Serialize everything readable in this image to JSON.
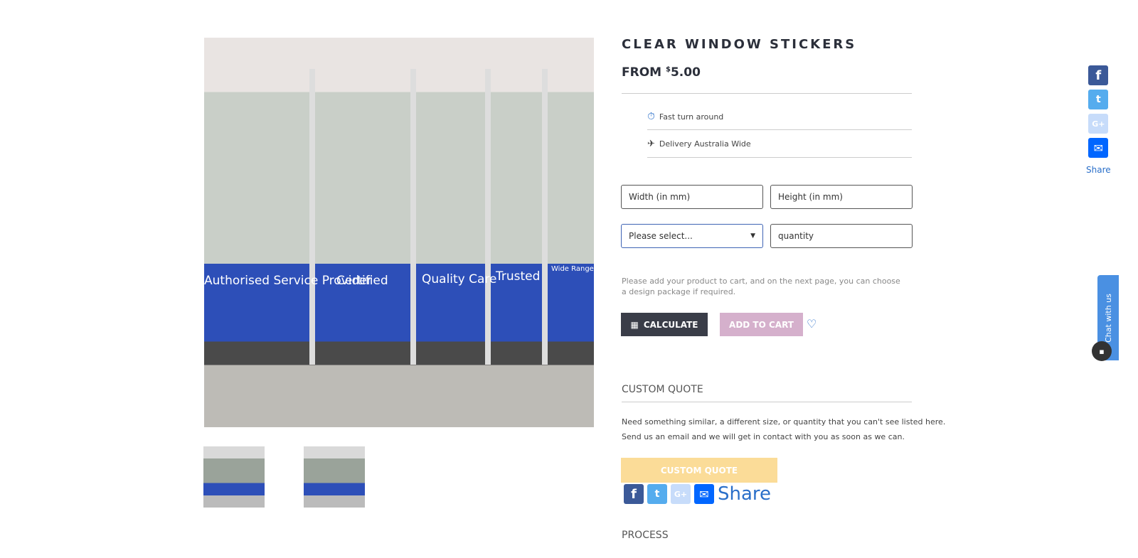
{
  "product": {
    "title": "CLEAR WINDOW STICKERS",
    "price_prefix": "FROM",
    "currency": "$",
    "price": "5.00"
  },
  "photo_signs": [
    "Authorised Service Provider",
    "Certified",
    "Quality Care",
    "Trusted",
    "Wide Range"
  ],
  "features": [
    {
      "icon": "stopwatch-icon",
      "label": "Fast turn around"
    },
    {
      "icon": "airplane-icon",
      "label": "Delivery Australia Wide"
    }
  ],
  "form": {
    "width_placeholder": "Width (in mm)",
    "height_placeholder": "Height (in mm)",
    "select_value": "Please select...",
    "quantity_placeholder": "quantity"
  },
  "note": "Please add your product to cart, and on the next page, you can choose a design package if required.",
  "buttons": {
    "calculate": "CALCULATE",
    "add_to_cart": "ADD TO CART",
    "custom_quote": "CUSTOM QUOTE"
  },
  "custom_quote": {
    "heading": "CUSTOM QUOTE",
    "line1": "Need something similar, a different size, or quantity that you can't see listed here.",
    "line2": "Send us an email and we will get in contact with you as soon as we can."
  },
  "share": {
    "label": "Share"
  },
  "process": {
    "heading": "PROCESS"
  },
  "chat": {
    "label": "Chat with us"
  },
  "colors": {
    "facebook": "#3b5998",
    "twitter": "#55acee",
    "google": "#c7dcfa",
    "email": "#0166ff",
    "calculate": "#3a3d48",
    "add_to_cart": "#d5b0cc",
    "custom_quote": "#fbdc98",
    "chat": "#4a90e2"
  }
}
